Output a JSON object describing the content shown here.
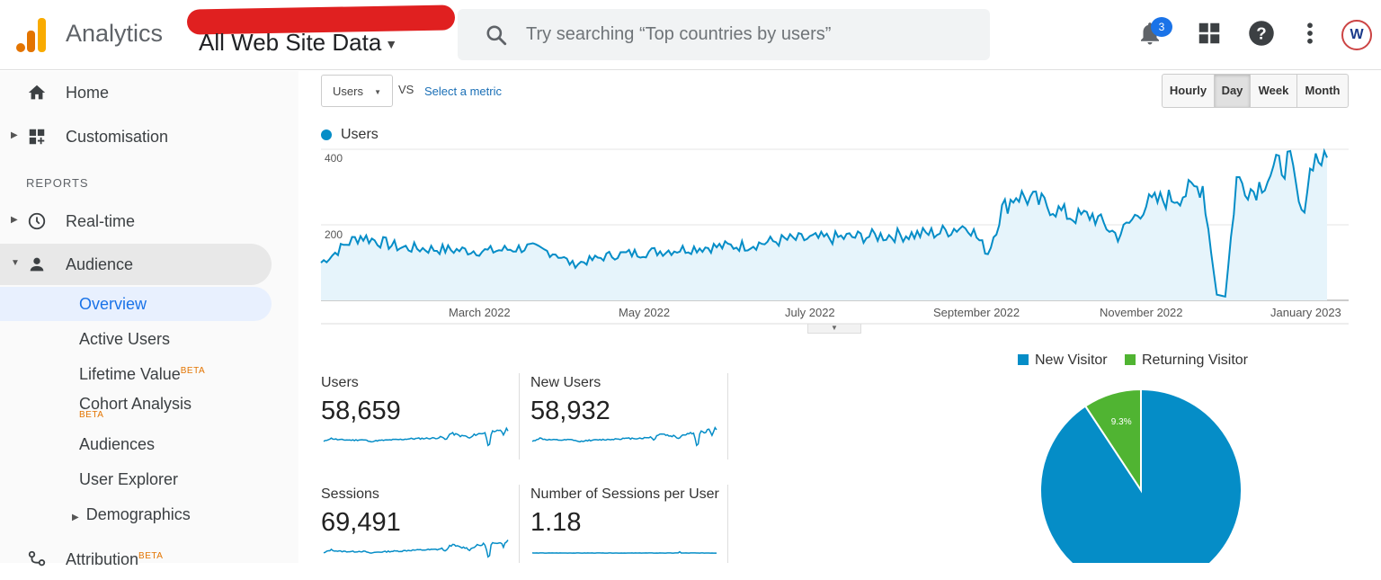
{
  "header": {
    "app_title": "Analytics",
    "property_name": "All Web Site Data",
    "search_placeholder": "Try searching “Top countries by users”",
    "notifications_count": "3",
    "avatar_initial": "W"
  },
  "sidebar": {
    "home": "Home",
    "customisation": "Customisation",
    "reports_header": "REPORTS",
    "realtime": "Real-time",
    "audience": "Audience",
    "audience_items": {
      "overview": "Overview",
      "active_users": "Active Users",
      "lifetime_value": "Lifetime Value",
      "cohort_analysis": "Cohort Analysis",
      "audiences": "Audiences",
      "user_explorer": "User Explorer",
      "demographics": "Demographics"
    },
    "attribution": "Attribution",
    "beta": "BETA"
  },
  "toolbar": {
    "metric": "Users",
    "vs": "VS",
    "select_metric": "Select a metric",
    "granularity": [
      "Hourly",
      "Day",
      "Week",
      "Month"
    ],
    "active_granularity": "Day"
  },
  "colors": {
    "line": "#058dc7",
    "area": "#e6f4fb",
    "new_visitor": "#058dc7",
    "returning_visitor": "#50b432"
  },
  "chart_data": [
    {
      "type": "area",
      "series": [
        {
          "name": "Users",
          "values_note": "daily"
        }
      ],
      "x_labels": [
        "March 2022",
        "May 2022",
        "July 2022",
        "September 2022",
        "November 2022",
        "January 2023"
      ],
      "y_ticks": [
        "400",
        "200"
      ],
      "ylim": [
        0,
        410
      ],
      "keypoints": [
        [
          "2022-02-01",
          100
        ],
        [
          "2022-02-05",
          120
        ],
        [
          "2022-02-10",
          150
        ],
        [
          "2022-02-15",
          170
        ],
        [
          "2022-03-01",
          140
        ],
        [
          "2022-03-15",
          135
        ],
        [
          "2022-04-01",
          130
        ],
        [
          "2022-04-15",
          140
        ],
        [
          "2022-04-25",
          125
        ],
        [
          "2022-05-01",
          95
        ],
        [
          "2022-05-15",
          120
        ],
        [
          "2022-06-01",
          130
        ],
        [
          "2022-06-15",
          140
        ],
        [
          "2022-07-01",
          145
        ],
        [
          "2022-07-15",
          160
        ],
        [
          "2022-08-01",
          165
        ],
        [
          "2022-08-15",
          170
        ],
        [
          "2022-09-01",
          175
        ],
        [
          "2022-09-08",
          180
        ],
        [
          "2022-09-18",
          200
        ],
        [
          "2022-09-25",
          125
        ],
        [
          "2022-09-30",
          240
        ],
        [
          "2022-10-05",
          280
        ],
        [
          "2022-10-15",
          255
        ],
        [
          "2022-10-25",
          220
        ],
        [
          "2022-11-01",
          225
        ],
        [
          "2022-11-10",
          170
        ],
        [
          "2022-11-20",
          255
        ],
        [
          "2022-12-01",
          275
        ],
        [
          "2022-12-10",
          305
        ],
        [
          "2022-12-15",
          15
        ],
        [
          "2022-12-18",
          10
        ],
        [
          "2022-12-22",
          320
        ],
        [
          "2022-12-28",
          290
        ],
        [
          "2023-01-05",
          350
        ],
        [
          "2023-01-10",
          370
        ],
        [
          "2023-01-14",
          220
        ],
        [
          "2023-01-18",
          380
        ],
        [
          "2023-01-23",
          370
        ]
      ]
    },
    {
      "type": "pie",
      "labels": [
        "New Visitor",
        "Returning Visitor"
      ],
      "values": [
        90.7,
        9.3
      ],
      "data_labels": [
        "",
        "9.3%"
      ]
    }
  ],
  "cards": [
    {
      "title": "Users",
      "value": "58,659"
    },
    {
      "title": "New Users",
      "value": "58,932"
    },
    {
      "title": "Sessions",
      "value": "69,491"
    },
    {
      "title": "Number of Sessions per User",
      "value": "1.18"
    }
  ]
}
